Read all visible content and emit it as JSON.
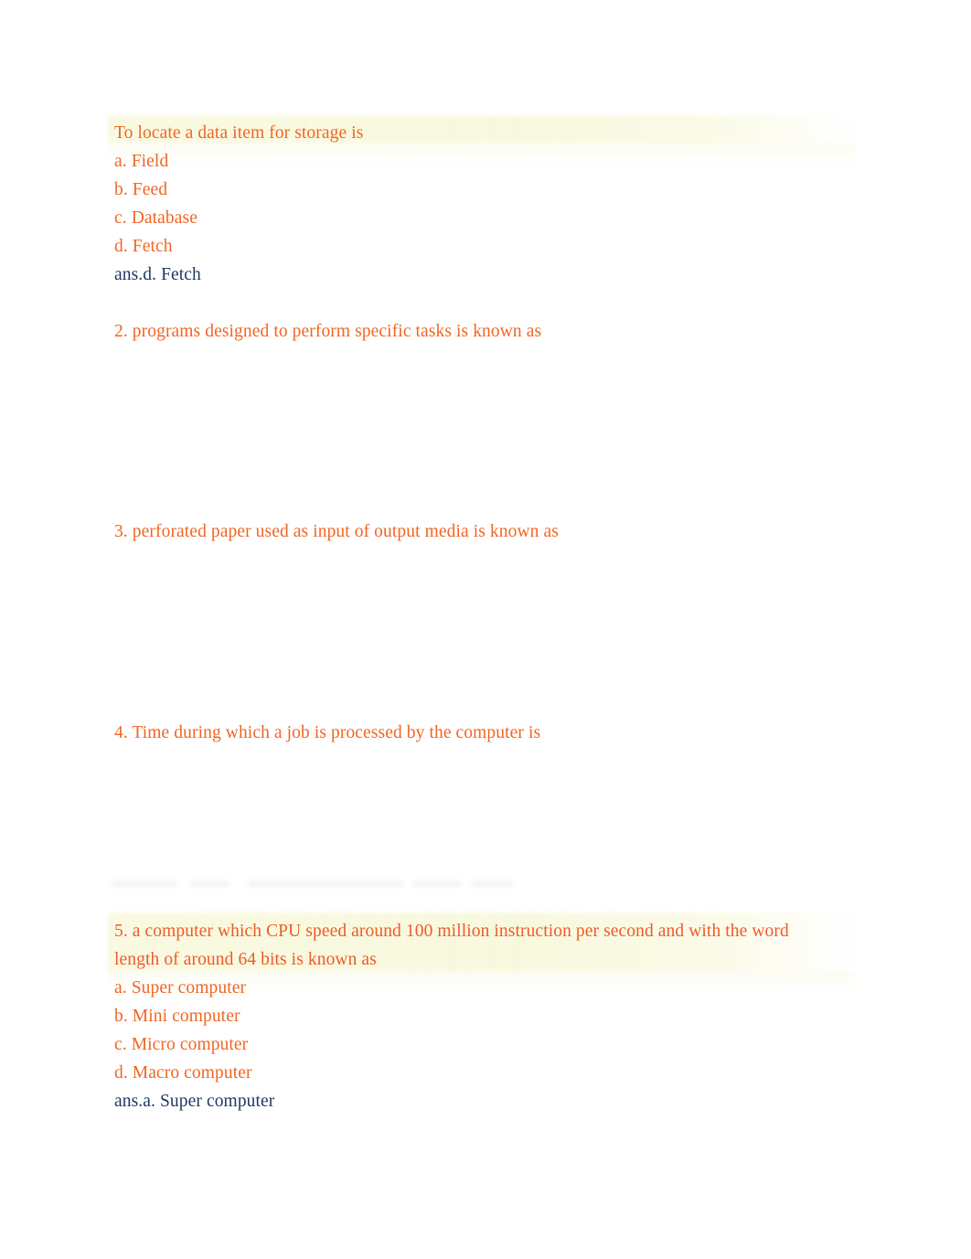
{
  "document": {
    "type": "quiz-worksheet",
    "text_color": "#F26522",
    "answer_color": "#1F3864",
    "highlight_color": "#F7F7E0",
    "background_color": "#FFFFFF"
  },
  "questions": [
    {
      "id": "q1",
      "prompt": "To locate a data item for storage is",
      "highlighted": true,
      "options": [
        "a. Field",
        "b. Feed",
        "c. Database",
        "d. Fetch"
      ],
      "answer": "ans.d. Fetch"
    },
    {
      "id": "q2",
      "prompt": "2. programs designed to perform specific tasks is known as",
      "highlighted": false,
      "options": [],
      "answer": ""
    },
    {
      "id": "q3",
      "prompt": "3. perforated paper used as input of output media is known as",
      "highlighted": false,
      "options": [],
      "answer": ""
    },
    {
      "id": "q4",
      "prompt": "4. Time during which a job is processed by the computer is",
      "highlighted": false,
      "options": [],
      "answer": ""
    },
    {
      "id": "q5",
      "prompt_line_1": "5. a computer which CPU speed around 100 million instruction per second and with the word",
      "prompt_line_2": "length of around 64 bits is known as",
      "highlighted": true,
      "options": [
        "a. Super computer",
        "b. Mini computer",
        "c. Micro computer",
        "d. Macro computer"
      ],
      "answer": "ans.a. Super computer"
    }
  ]
}
